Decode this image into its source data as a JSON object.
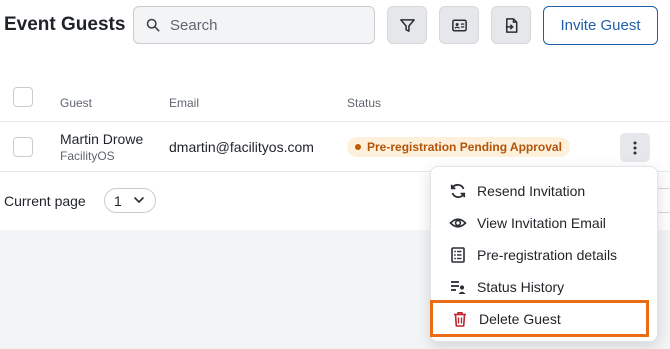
{
  "header": {
    "title": "Event Guests",
    "search_placeholder": "Search",
    "invite_label": "Invite Guest"
  },
  "table": {
    "columns": [
      "Guest",
      "Email",
      "Status"
    ],
    "rows": [
      {
        "name": "Martin Drowe",
        "org": "FacilityOS",
        "email": "dmartin@facilityos.com",
        "status": "Pre-registration Pending Approval"
      }
    ]
  },
  "pagination": {
    "label": "Current page",
    "value": "1"
  },
  "menu": {
    "items": [
      {
        "label": "Resend Invitation",
        "icon": "refresh-icon"
      },
      {
        "label": "View Invitation Email",
        "icon": "eye-icon"
      },
      {
        "label": "Pre-registration details",
        "icon": "list-icon"
      },
      {
        "label": "Status History",
        "icon": "status-history-icon"
      },
      {
        "label": "Delete Guest",
        "icon": "trash-icon"
      }
    ]
  },
  "colors": {
    "accent": "#1f5fa6",
    "status_text": "#b45309",
    "status_bg": "#fdf1dc",
    "delete_icon": "#c0262d",
    "highlight": "#ea6c13"
  }
}
